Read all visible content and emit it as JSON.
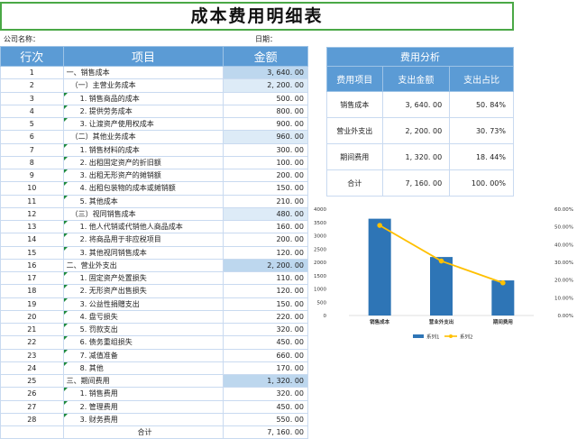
{
  "title": "成本费用明细表",
  "company_label": "公司名称：",
  "date_label": "日期：",
  "table": {
    "headers": [
      "行次",
      "项目",
      "金额"
    ],
    "rows": [
      {
        "n": "1",
        "item": "一、销售成本",
        "amount": "3, 640. 00",
        "lv": 1,
        "cls": "sec"
      },
      {
        "n": "2",
        "item": "（一）主营业务成本",
        "amount": "2, 200. 00",
        "lv": 2,
        "cls": "sub"
      },
      {
        "n": "3",
        "item": "1. 销售商品的成本",
        "amount": "500. 00",
        "lv": 3,
        "cls": ""
      },
      {
        "n": "4",
        "item": "2. 提供劳务成本",
        "amount": "800. 00",
        "lv": 3,
        "cls": ""
      },
      {
        "n": "5",
        "item": "3. 让渡资产使用权成本",
        "amount": "900. 00",
        "lv": 3,
        "cls": ""
      },
      {
        "n": "6",
        "item": "（二）其他业务成本",
        "amount": "960. 00",
        "lv": 2,
        "cls": "sub"
      },
      {
        "n": "7",
        "item": "1. 销售材料的成本",
        "amount": "300. 00",
        "lv": 3,
        "cls": ""
      },
      {
        "n": "8",
        "item": "2. 出租固定资产的折旧额",
        "amount": "100. 00",
        "lv": 3,
        "cls": ""
      },
      {
        "n": "9",
        "item": "3. 出租无形资产的摊销额",
        "amount": "200. 00",
        "lv": 3,
        "cls": ""
      },
      {
        "n": "10",
        "item": "4. 出租包装物的成本或摊销额",
        "amount": "150. 00",
        "lv": 3,
        "cls": ""
      },
      {
        "n": "11",
        "item": "5. 其他成本",
        "amount": "210. 00",
        "lv": 3,
        "cls": ""
      },
      {
        "n": "12",
        "item": "（三）视同销售成本",
        "amount": "480. 00",
        "lv": 2,
        "cls": "sub"
      },
      {
        "n": "13",
        "item": "1. 他人代销或代销他人商品成本",
        "amount": "160. 00",
        "lv": 3,
        "cls": ""
      },
      {
        "n": "14",
        "item": "2. 将商品用于非应税项目",
        "amount": "200. 00",
        "lv": 3,
        "cls": ""
      },
      {
        "n": "15",
        "item": "3. 其他视同销售成本",
        "amount": "120. 00",
        "lv": 3,
        "cls": ""
      },
      {
        "n": "16",
        "item": "二、营业外支出",
        "amount": "2, 200. 00",
        "lv": 1,
        "cls": "sec"
      },
      {
        "n": "17",
        "item": "1. 固定资产处置损失",
        "amount": "110. 00",
        "lv": 3,
        "cls": ""
      },
      {
        "n": "18",
        "item": "2. 无形资产出售损失",
        "amount": "120. 00",
        "lv": 3,
        "cls": ""
      },
      {
        "n": "19",
        "item": "3. 公益性捐赠支出",
        "amount": "150. 00",
        "lv": 3,
        "cls": ""
      },
      {
        "n": "20",
        "item": "4. 盘亏损失",
        "amount": "220. 00",
        "lv": 3,
        "cls": ""
      },
      {
        "n": "21",
        "item": "5. 罚款支出",
        "amount": "320. 00",
        "lv": 3,
        "cls": ""
      },
      {
        "n": "22",
        "item": "6. 债务重组损失",
        "amount": "450. 00",
        "lv": 3,
        "cls": ""
      },
      {
        "n": "23",
        "item": "7. 减值准备",
        "amount": "660. 00",
        "lv": 3,
        "cls": ""
      },
      {
        "n": "24",
        "item": "8. 其他",
        "amount": "170. 00",
        "lv": 3,
        "cls": ""
      },
      {
        "n": "25",
        "item": "三、期间费用",
        "amount": "1, 320. 00",
        "lv": 1,
        "cls": "sec"
      },
      {
        "n": "26",
        "item": "1. 销售费用",
        "amount": "320. 00",
        "lv": 3,
        "cls": ""
      },
      {
        "n": "27",
        "item": "2. 管理费用",
        "amount": "450. 00",
        "lv": 3,
        "cls": ""
      },
      {
        "n": "28",
        "item": "3. 财务费用",
        "amount": "550. 00",
        "lv": 3,
        "cls": ""
      }
    ],
    "total_label": "合计",
    "total_amount": "7, 160. 00"
  },
  "analysis": {
    "title": "费用分析",
    "headers": [
      "费用项目",
      "支出金额",
      "支出占比"
    ],
    "rows": [
      {
        "item": "销售成本",
        "amount": "3, 640. 00",
        "pct": "50. 84%"
      },
      {
        "item": "营业外支出",
        "amount": "2, 200. 00",
        "pct": "30. 73%"
      },
      {
        "item": "期间费用",
        "amount": "1, 320. 00",
        "pct": "18. 44%"
      },
      {
        "item": "合计",
        "amount": "7, 160. 00",
        "pct": "100. 00%"
      }
    ]
  },
  "chart_data": {
    "type": "bar",
    "categories": [
      "销售成本",
      "营业外支出",
      "期间费用"
    ],
    "series": [
      {
        "name": "系列1",
        "type": "bar",
        "axis": "left",
        "values": [
          3640,
          2200,
          1320
        ],
        "color": "#2e75b6"
      },
      {
        "name": "系列2",
        "type": "line",
        "axis": "right",
        "values": [
          0.5084,
          0.3073,
          0.1844
        ],
        "color": "#ffc000"
      }
    ],
    "left_ticks": [
      "4000",
      "3500",
      "3000",
      "2500",
      "2000",
      "1500",
      "1000",
      "500",
      "0"
    ],
    "right_ticks": [
      "60.00%",
      "50.00%",
      "40.00%",
      "30.00%",
      "20.00%",
      "10.00%",
      "0.00%"
    ],
    "ylim_left": [
      0,
      4000
    ],
    "ylim_right": [
      0,
      0.6
    ],
    "legend": "bottom"
  }
}
